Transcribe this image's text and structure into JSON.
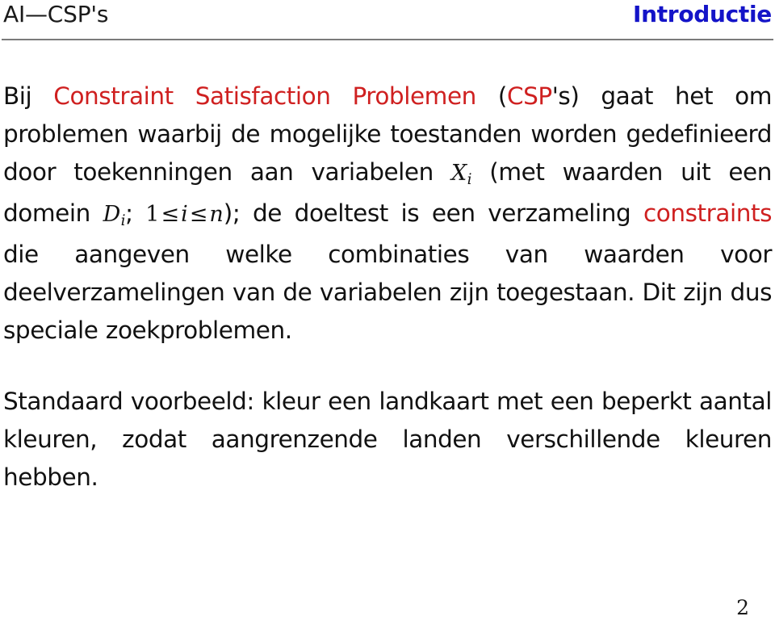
{
  "header": {
    "left_title": "AI—CSP's",
    "right_title": "Introductie",
    "accent_blue": "#1414c8",
    "rule_color": "#7a7a7a"
  },
  "colors": {
    "highlight_red": "#cf2020",
    "text_black": "#111111",
    "background": "#ffffff"
  },
  "body": {
    "paragraph1": {
      "full_text": "Bij Constraint Satisfaction Problemen (CSP's) gaat het om problemen waarbij de mogelijke toestanden worden gedefinieerd door toekenningen aan variabelen X_i (met waarden uit een domein D_i; 1 ≤ i ≤ n); de doeltest is een verzameling constraints die aangeven welke combinaties van waarden voor deelverzamelingen van de variabelen zijn toegestaan. Dit zijn dus speciale zoekproblemen.",
      "seg1": "Bij ",
      "seg2_red": "Constraint Satisfaction Problemen",
      "seg3": " (",
      "seg4_red": "CSP",
      "seg5": "'s) gaat het om problemen waarbij de mogelijke toestanden worden gedefinieerd door toekenningen aan variabelen ",
      "math_X": "X",
      "math_X_sub": "i",
      "seg6": " (met waarden uit een domein ",
      "math_D": "D",
      "math_D_sub": "i",
      "seg7": "; ",
      "math_one": "1",
      "math_le1": "≤",
      "math_i": "i",
      "math_le2": "≤",
      "math_n": "n",
      "seg8": "); de doeltest is een ver­zameling ",
      "seg9_red": "constraints",
      "seg10": " die aangeven welke combinaties van waarden voor deelverzamelingen van de variabelen zijn toegestaan. Dit zijn dus speciale zoekproblemen."
    },
    "paragraph2": {
      "full_text": "Standaard voorbeeld: kleur een landkaart met een beperkt aantal kleuren, zodat aangrenzende landen verschillende kleuren hebben."
    }
  },
  "footer": {
    "page_number": "2"
  }
}
